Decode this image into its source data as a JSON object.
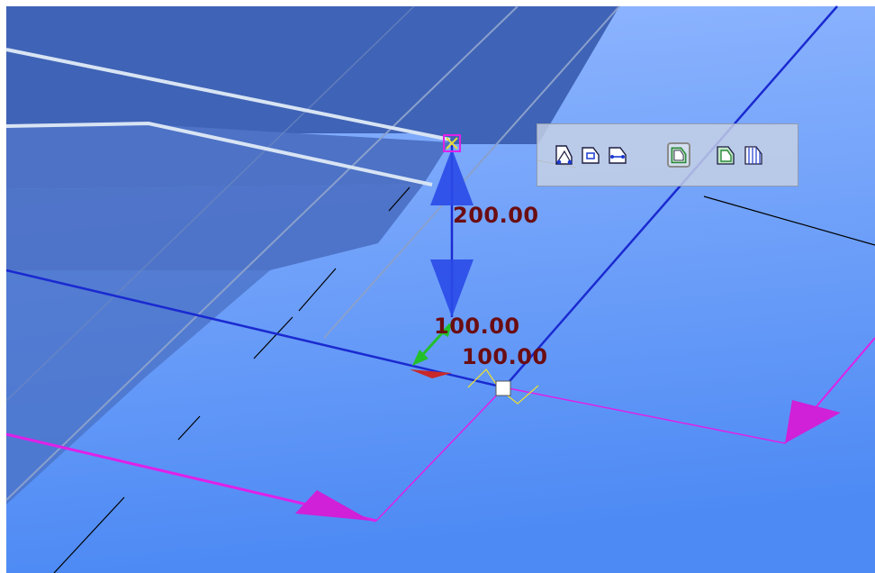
{
  "viewport": {
    "dimensions": [
      {
        "id": "dim-vertical",
        "value": "200.00"
      },
      {
        "id": "dim-green-axis",
        "value": "100.00"
      },
      {
        "id": "dim-red-axis",
        "value": "100.00"
      }
    ]
  },
  "toolbar": {
    "tools": [
      {
        "icon": "face-vertex-icon",
        "active": false
      },
      {
        "icon": "face-edge-icon",
        "active": false
      },
      {
        "icon": "edge-midpoint-icon",
        "active": false
      },
      {
        "icon": "face-selection-icon",
        "active": true
      },
      {
        "icon": "face-fill-icon",
        "active": false
      },
      {
        "icon": "pattern-lines-icon",
        "active": false
      }
    ]
  },
  "colors": {
    "background_top": "#8fb4ff",
    "background_bottom": "#4a88f5",
    "dimension_text": "#6b0d12",
    "axis_blue": "#1a2ad0",
    "axis_magenta": "#e020e8",
    "axis_green": "#22c02a",
    "toolbar_active_outline": "#2c8a3c"
  }
}
